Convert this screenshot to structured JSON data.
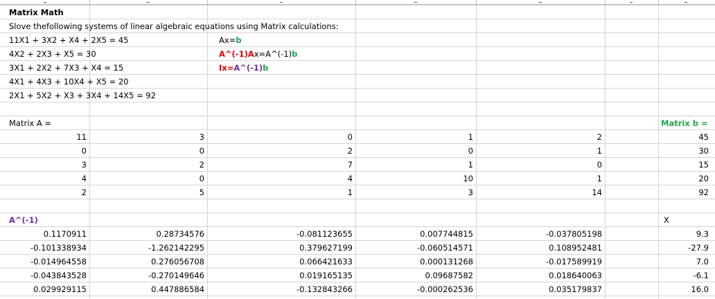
{
  "title": "Matrix Math",
  "instruction": "Slove thefollowing systems of linear algebraic equations using Matrix calculations:",
  "equations": [
    "11X1 + 3X2 + X4 + 2X5 = 45",
    "4X2 + 2X3 + X5 = 30",
    "3X1 + 2X2 + 7X3 + X4 = 15",
    "4X1 + 4X3 + 10X4 + X5 = 20",
    "2X1 + 5X2 + X3 + 3X4 + 14X5 = 92"
  ],
  "formulas": {
    "f1_pre": "Ax=",
    "f1_b": "b",
    "f2_inv": "A^(-1)A",
    "f2_mid": "x=A^(-1)",
    "f2_b": "b",
    "f3_pre": "Ix=",
    "f3_inv": "A^(-1)",
    "f3_b": "b"
  },
  "labels": {
    "matrixA": "Matrix A =",
    "matrixB": "Matrix b =",
    "inverse": "A^(-1)",
    "x": "X"
  },
  "colors": {
    "green": "#22a54a",
    "red": "#e00000",
    "purple": "#7030a0",
    "grid": "#d4d4d4"
  },
  "matrixA": [
    [
      "11",
      "3",
      "0",
      "1",
      "2"
    ],
    [
      "0",
      "0",
      "2",
      "0",
      "1"
    ],
    [
      "3",
      "2",
      "7",
      "1",
      "0"
    ],
    [
      "4",
      "0",
      "4",
      "10",
      "1"
    ],
    [
      "2",
      "5",
      "1",
      "3",
      "14"
    ]
  ],
  "matrixB": [
    "45",
    "30",
    "15",
    "20",
    "92"
  ],
  "inverseA": [
    [
      "0.1170911",
      "0.28734576",
      "-0.081123655",
      "0.007744815",
      "-0.037805198"
    ],
    [
      "-0.101338934",
      "-1.262142295",
      "0.379627199",
      "-0.060514571",
      "0.108952481"
    ],
    [
      "-0.014964558",
      "0.276056708",
      "0.066421633",
      "0.000131268",
      "-0.017589919"
    ],
    [
      "-0.043843528",
      "-0.270149646",
      "0.019165135",
      "0.09687582",
      "0.018640063"
    ],
    [
      "0.029929115",
      "0.447886584",
      "-0.132843266",
      "-0.000262536",
      "0.035179837"
    ]
  ],
  "solutionX": [
    "9.3",
    "-27.9",
    "7.0",
    "-6.1",
    "16.0"
  ]
}
